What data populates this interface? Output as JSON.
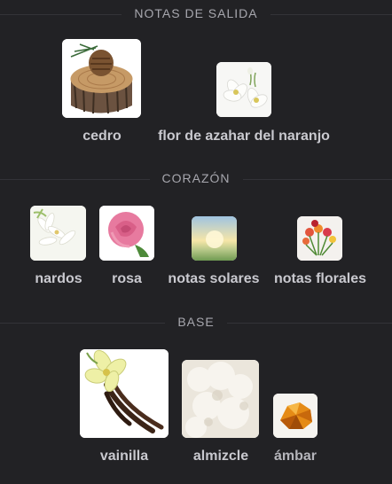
{
  "sections": [
    {
      "title": "NOTAS DE SALIDA",
      "notes": [
        {
          "label": "cedro",
          "icon": "cedar-wood-slice-icon"
        },
        {
          "label": "flor de azahar del naranjo",
          "icon": "orange-blossom-icon"
        }
      ]
    },
    {
      "title": "CORAZÓN",
      "notes": [
        {
          "label": "nardos",
          "icon": "tuberose-icon"
        },
        {
          "label": "rosa",
          "icon": "rose-icon"
        },
        {
          "label": "notas solares",
          "icon": "sunlight-icon"
        },
        {
          "label": "notas florales",
          "icon": "flower-bouquet-icon"
        }
      ]
    },
    {
      "title": "BASE",
      "notes": [
        {
          "label": "vainilla",
          "icon": "vanilla-icon"
        },
        {
          "label": "almizcle",
          "icon": "musk-icon"
        },
        {
          "label": "ámbar",
          "icon": "amber-icon"
        }
      ]
    }
  ]
}
